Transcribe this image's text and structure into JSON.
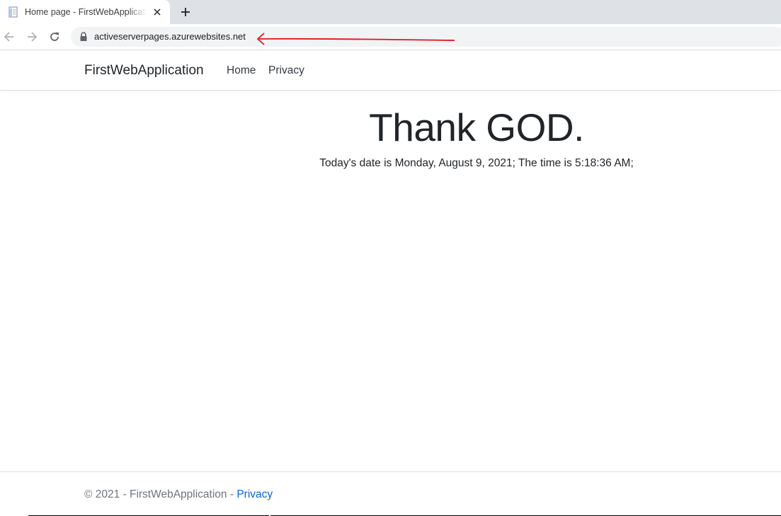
{
  "browser": {
    "tab": {
      "title": "Home page - FirstWebApplication",
      "favicon": "page-document-icon",
      "close": "close-icon"
    },
    "new_tab": "plus-icon",
    "toolbar": {
      "back": "arrow-left-icon",
      "forward": "arrow-right-icon",
      "reload": "reload-icon",
      "lock": "lock-icon",
      "url": "activeserverpages.azurewebsites.net"
    },
    "annotation": {
      "icon": "red-arrow-icon",
      "color": "#e3131f"
    }
  },
  "site": {
    "brand": "FirstWebApplication",
    "nav": [
      {
        "label": "Home"
      },
      {
        "label": "Privacy"
      }
    ]
  },
  "main": {
    "heading": "Thank GOD.",
    "subtext": "Today's date is Monday, August 9, 2021; The time is 5:18:36 AM;"
  },
  "footer": {
    "prefix": "© 2021 - FirstWebApplication - ",
    "link": "Privacy",
    "link_color": "#0366d6"
  }
}
